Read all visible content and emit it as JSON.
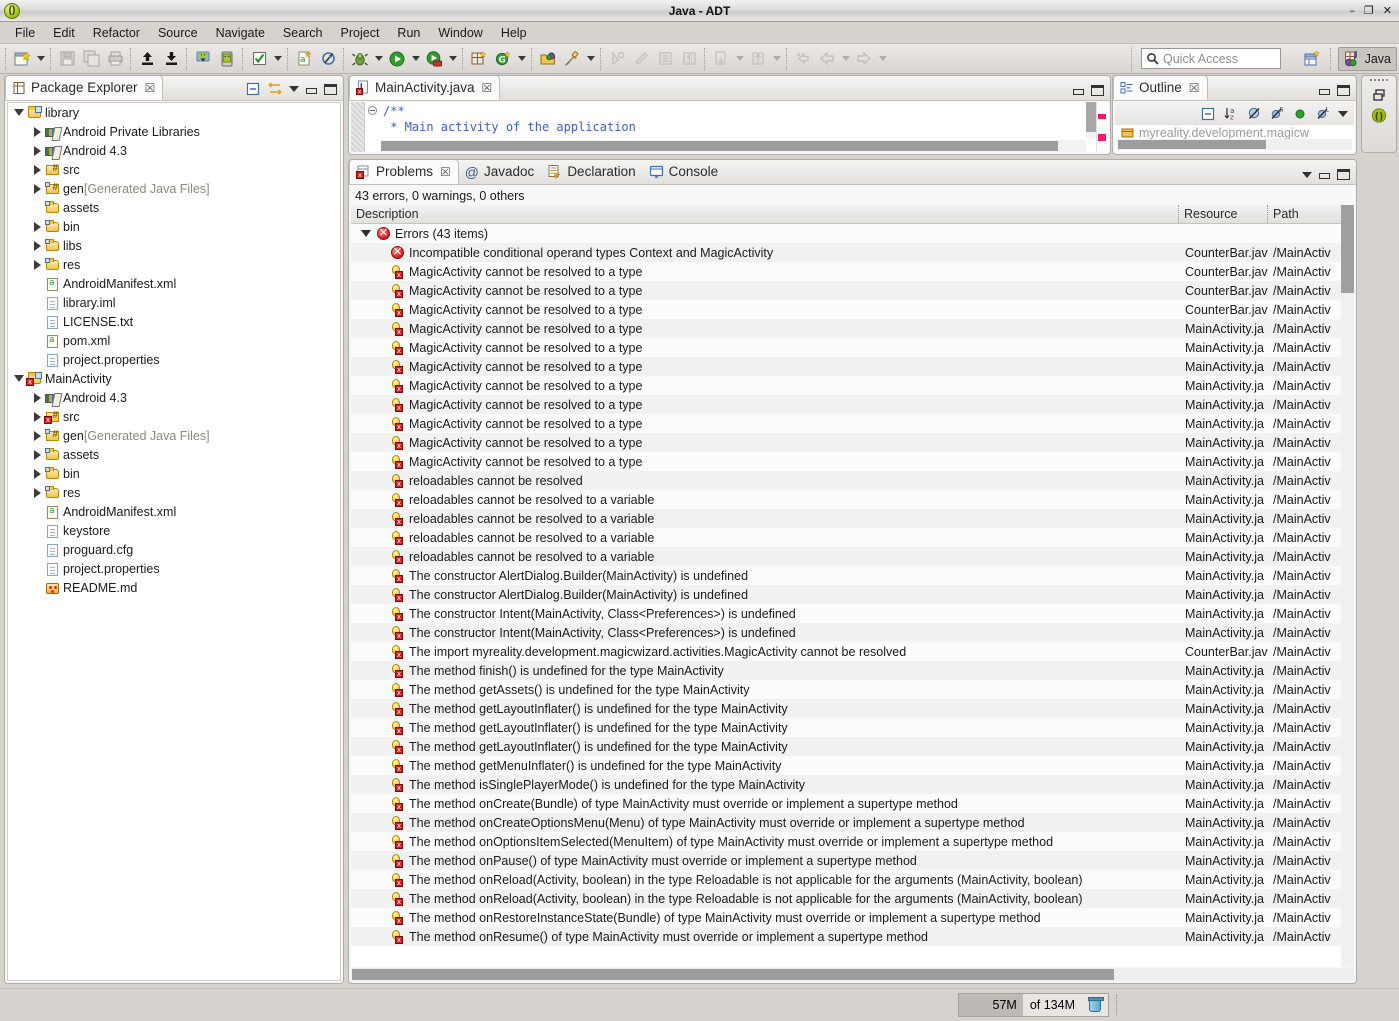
{
  "window": {
    "title": "Java - ADT",
    "app_icon": "eclipse-icon",
    "minimize": "–",
    "restore": "❐",
    "close": "✕"
  },
  "menubar": {
    "items": [
      "File",
      "Edit",
      "Refactor",
      "Source",
      "Navigate",
      "Search",
      "Project",
      "Run",
      "Window",
      "Help"
    ]
  },
  "toolbar": {
    "groups": [
      {
        "items": [
          {
            "name": "new-wizard-icon",
            "arrow": true
          },
          {
            "name": "save-icon",
            "arrow": false
          },
          {
            "name": "save-all-icon",
            "arrow": false
          },
          {
            "name": "print-icon",
            "arrow": false
          }
        ]
      },
      {
        "items": [
          {
            "name": "export-icon",
            "arrow": false
          },
          {
            "name": "import-icon",
            "arrow": false
          }
        ]
      },
      {
        "items": [
          {
            "name": "android-sdk-manager-icon",
            "arrow": false
          },
          {
            "name": "android-avd-manager-icon",
            "arrow": false
          }
        ]
      },
      {
        "items": [
          {
            "name": "build-check-icon",
            "arrow": true
          }
        ]
      },
      {
        "items": [
          {
            "name": "new-android-xml-icon",
            "arrow": false
          },
          {
            "name": "lint-warnings-icon",
            "arrow": false
          }
        ]
      },
      {
        "items": [
          {
            "name": "debug-icon",
            "arrow": true
          },
          {
            "name": "run-icon",
            "arrow": true
          },
          {
            "name": "run-history-icon",
            "arrow": true
          }
        ]
      },
      {
        "items": [
          {
            "name": "new-java-class-icon",
            "arrow": false
          },
          {
            "name": "new-java-project-icon",
            "arrow": true
          }
        ]
      },
      {
        "items": [
          {
            "name": "open-type-icon",
            "arrow": false
          },
          {
            "name": "search-icon",
            "arrow": true
          }
        ]
      },
      {
        "items": [
          {
            "name": "next-annotation-icon",
            "arrow": false
          },
          {
            "name": "previous-annotation-icon",
            "arrow": false
          },
          {
            "name": "toggle-block-selection-icon",
            "arrow": false
          },
          {
            "name": "show-whitespace-icon",
            "arrow": false
          }
        ]
      },
      {
        "items": [
          {
            "name": "last-edit-location-icon",
            "arrow": true
          },
          {
            "name": "go-to-line-icon",
            "arrow": true
          }
        ]
      },
      {
        "items": [
          {
            "name": "back-history-icon",
            "arrow": false
          },
          {
            "name": "back-icon",
            "arrow": true
          },
          {
            "name": "forward-icon",
            "arrow": true
          }
        ]
      }
    ],
    "quick_access": {
      "placeholder": "Quick Access",
      "value": "",
      "icon": "search-icon"
    },
    "open_perspective_icon": "open-perspective-icon",
    "perspective": {
      "label": "Java",
      "icon": "java-perspective-icon",
      "active": true
    }
  },
  "package_explorer": {
    "title": "Package Explorer",
    "close_glyph": "☒",
    "actions": [
      {
        "name": "collapse-all-icon"
      },
      {
        "name": "link-with-editor-icon"
      },
      {
        "name": "view-menu-icon"
      },
      {
        "name": "minimize-icon"
      },
      {
        "name": "maximize-icon"
      }
    ],
    "tree": [
      {
        "indent": 0,
        "twist": "open",
        "icon": "java-project-icon",
        "label": "library",
        "dim": ""
      },
      {
        "indent": 1,
        "twist": "closed",
        "icon": "library-icon",
        "label": "Android Private Libraries",
        "dim": ""
      },
      {
        "indent": 1,
        "twist": "closed",
        "icon": "library-icon",
        "label": "Android 4.3",
        "dim": ""
      },
      {
        "indent": 1,
        "twist": "closed",
        "icon": "source-folder-icon",
        "label": "src",
        "dim": ""
      },
      {
        "indent": 1,
        "twist": "closed",
        "icon": "gen-folder-icon",
        "label": "gen",
        "dim": "[Generated Java Files]"
      },
      {
        "indent": 1,
        "twist": "none",
        "icon": "folder-icon",
        "label": "assets",
        "dim": ""
      },
      {
        "indent": 1,
        "twist": "closed",
        "icon": "folder-icon",
        "label": "bin",
        "dim": ""
      },
      {
        "indent": 1,
        "twist": "closed",
        "icon": "folder-icon",
        "label": "libs",
        "dim": ""
      },
      {
        "indent": 1,
        "twist": "closed",
        "icon": "folder-icon",
        "label": "res",
        "dim": ""
      },
      {
        "indent": 1,
        "twist": "none",
        "icon": "xml-file-icon",
        "label": "AndroidManifest.xml",
        "dim": ""
      },
      {
        "indent": 1,
        "twist": "none",
        "icon": "file-icon",
        "label": "library.iml",
        "dim": ""
      },
      {
        "indent": 1,
        "twist": "none",
        "icon": "file-icon",
        "label": "LICENSE.txt",
        "dim": ""
      },
      {
        "indent": 1,
        "twist": "none",
        "icon": "xml-file-icon",
        "label": "pom.xml",
        "dim": ""
      },
      {
        "indent": 1,
        "twist": "none",
        "icon": "file-icon",
        "label": "project.properties",
        "dim": ""
      },
      {
        "indent": 0,
        "twist": "open",
        "icon": "java-project-error-icon",
        "label": "MainActivity",
        "dim": ""
      },
      {
        "indent": 1,
        "twist": "closed",
        "icon": "library-icon",
        "label": "Android 4.3",
        "dim": ""
      },
      {
        "indent": 1,
        "twist": "closed",
        "icon": "source-folder-error-icon",
        "label": "src",
        "dim": ""
      },
      {
        "indent": 1,
        "twist": "closed",
        "icon": "gen-folder-icon",
        "label": "gen",
        "dim": "[Generated Java Files]"
      },
      {
        "indent": 1,
        "twist": "closed",
        "icon": "folder-icon",
        "label": "assets",
        "dim": ""
      },
      {
        "indent": 1,
        "twist": "closed",
        "icon": "folder-icon",
        "label": "bin",
        "dim": ""
      },
      {
        "indent": 1,
        "twist": "closed",
        "icon": "folder-icon",
        "label": "res",
        "dim": ""
      },
      {
        "indent": 1,
        "twist": "none",
        "icon": "xml-file-icon",
        "label": "AndroidManifest.xml",
        "dim": ""
      },
      {
        "indent": 1,
        "twist": "none",
        "icon": "file-icon",
        "label": "keystore",
        "dim": ""
      },
      {
        "indent": 1,
        "twist": "none",
        "icon": "file-icon",
        "label": "proguard.cfg",
        "dim": ""
      },
      {
        "indent": 1,
        "twist": "none",
        "icon": "file-icon",
        "label": "project.properties",
        "dim": ""
      },
      {
        "indent": 1,
        "twist": "none",
        "icon": "markdown-file-icon",
        "label": "README.md",
        "dim": ""
      }
    ]
  },
  "editor": {
    "tab": {
      "label": "MainActivity.java",
      "icon": "java-file-error-icon",
      "close_glyph": "☒"
    },
    "lines": [
      "/**",
      " * Main activity of the application"
    ],
    "fold_marker": "collapse-fold-icon"
  },
  "outline": {
    "title": "Outline",
    "close_glyph": "☒",
    "actions": [
      {
        "name": "minimize-icon"
      },
      {
        "name": "maximize-icon"
      }
    ],
    "toolbar": [
      {
        "name": "collapse-all-icon"
      },
      {
        "name": "sort-icon"
      },
      {
        "name": "hide-fields-icon"
      },
      {
        "name": "hide-static-icon"
      },
      {
        "name": "hide-nonpublic-icon"
      },
      {
        "name": "hide-local-types-icon"
      },
      {
        "name": "view-menu-icon"
      }
    ],
    "rows": [
      {
        "icon": "package-icon",
        "label": "myreality.development.magicw"
      }
    ]
  },
  "problems": {
    "tabs": [
      {
        "label": "Problems",
        "icon": "problems-icon",
        "active": true,
        "close_glyph": "☒"
      },
      {
        "label": "Javadoc",
        "icon": "javadoc-icon",
        "active": false
      },
      {
        "label": "Declaration",
        "icon": "declaration-icon",
        "active": false
      },
      {
        "label": "Console",
        "icon": "console-icon",
        "active": false
      }
    ],
    "actions": [
      {
        "name": "view-menu-icon"
      },
      {
        "name": "minimize-icon"
      },
      {
        "name": "maximize-icon"
      }
    ],
    "summary": "43 errors, 0 warnings, 0 others",
    "columns": [
      "Description",
      "Resource",
      "Path"
    ],
    "group": {
      "twist": "open",
      "icon": "error-icon",
      "label": "Errors (43 items)"
    },
    "rows": [
      {
        "icon": "error-icon",
        "description": "Incompatible conditional operand types Context and MagicActivity",
        "resource": "CounterBar.jav",
        "path": "/MainActiv"
      },
      {
        "icon": "quickfix-error-icon",
        "description": "MagicActivity cannot be resolved to a type",
        "resource": "CounterBar.jav",
        "path": "/MainActiv"
      },
      {
        "icon": "quickfix-error-icon",
        "description": "MagicActivity cannot be resolved to a type",
        "resource": "CounterBar.jav",
        "path": "/MainActiv"
      },
      {
        "icon": "quickfix-error-icon",
        "description": "MagicActivity cannot be resolved to a type",
        "resource": "CounterBar.jav",
        "path": "/MainActiv"
      },
      {
        "icon": "quickfix-error-icon",
        "description": "MagicActivity cannot be resolved to a type",
        "resource": "MainActivity.ja",
        "path": "/MainActiv"
      },
      {
        "icon": "quickfix-error-icon",
        "description": "MagicActivity cannot be resolved to a type",
        "resource": "MainActivity.ja",
        "path": "/MainActiv"
      },
      {
        "icon": "quickfix-error-icon",
        "description": "MagicActivity cannot be resolved to a type",
        "resource": "MainActivity.ja",
        "path": "/MainActiv"
      },
      {
        "icon": "quickfix-error-icon",
        "description": "MagicActivity cannot be resolved to a type",
        "resource": "MainActivity.ja",
        "path": "/MainActiv"
      },
      {
        "icon": "quickfix-error-icon",
        "description": "MagicActivity cannot be resolved to a type",
        "resource": "MainActivity.ja",
        "path": "/MainActiv"
      },
      {
        "icon": "quickfix-error-icon",
        "description": "MagicActivity cannot be resolved to a type",
        "resource": "MainActivity.ja",
        "path": "/MainActiv"
      },
      {
        "icon": "quickfix-error-icon",
        "description": "MagicActivity cannot be resolved to a type",
        "resource": "MainActivity.ja",
        "path": "/MainActiv"
      },
      {
        "icon": "quickfix-error-icon",
        "description": "MagicActivity cannot be resolved to a type",
        "resource": "MainActivity.ja",
        "path": "/MainActiv"
      },
      {
        "icon": "quickfix-error-icon",
        "description": "reloadables cannot be resolved",
        "resource": "MainActivity.ja",
        "path": "/MainActiv"
      },
      {
        "icon": "quickfix-error-icon",
        "description": "reloadables cannot be resolved to a variable",
        "resource": "MainActivity.ja",
        "path": "/MainActiv"
      },
      {
        "icon": "quickfix-error-icon",
        "description": "reloadables cannot be resolved to a variable",
        "resource": "MainActivity.ja",
        "path": "/MainActiv"
      },
      {
        "icon": "quickfix-error-icon",
        "description": "reloadables cannot be resolved to a variable",
        "resource": "MainActivity.ja",
        "path": "/MainActiv"
      },
      {
        "icon": "quickfix-error-icon",
        "description": "reloadables cannot be resolved to a variable",
        "resource": "MainActivity.ja",
        "path": "/MainActiv"
      },
      {
        "icon": "quickfix-error-icon",
        "description": "The constructor AlertDialog.Builder(MainActivity) is undefined",
        "resource": "MainActivity.ja",
        "path": "/MainActiv"
      },
      {
        "icon": "quickfix-error-icon",
        "description": "The constructor AlertDialog.Builder(MainActivity) is undefined",
        "resource": "MainActivity.ja",
        "path": "/MainActiv"
      },
      {
        "icon": "quickfix-error-icon",
        "description": "The constructor Intent(MainActivity, Class<Preferences>) is undefined",
        "resource": "MainActivity.ja",
        "path": "/MainActiv"
      },
      {
        "icon": "quickfix-error-icon",
        "description": "The constructor Intent(MainActivity, Class<Preferences>) is undefined",
        "resource": "MainActivity.ja",
        "path": "/MainActiv"
      },
      {
        "icon": "quickfix-error-icon",
        "description": "The import myreality.development.magicwizard.activities.MagicActivity cannot be resolved",
        "resource": "CounterBar.jav",
        "path": "/MainActiv"
      },
      {
        "icon": "quickfix-error-icon",
        "description": "The method finish() is undefined for the type MainActivity",
        "resource": "MainActivity.ja",
        "path": "/MainActiv"
      },
      {
        "icon": "quickfix-error-icon",
        "description": "The method getAssets() is undefined for the type MainActivity",
        "resource": "MainActivity.ja",
        "path": "/MainActiv"
      },
      {
        "icon": "quickfix-error-icon",
        "description": "The method getLayoutInflater() is undefined for the type MainActivity",
        "resource": "MainActivity.ja",
        "path": "/MainActiv"
      },
      {
        "icon": "quickfix-error-icon",
        "description": "The method getLayoutInflater() is undefined for the type MainActivity",
        "resource": "MainActivity.ja",
        "path": "/MainActiv"
      },
      {
        "icon": "quickfix-error-icon",
        "description": "The method getLayoutInflater() is undefined for the type MainActivity",
        "resource": "MainActivity.ja",
        "path": "/MainActiv"
      },
      {
        "icon": "quickfix-error-icon",
        "description": "The method getMenuInflater() is undefined for the type MainActivity",
        "resource": "MainActivity.ja",
        "path": "/MainActiv"
      },
      {
        "icon": "quickfix-error-icon",
        "description": "The method isSinglePlayerMode() is undefined for the type MainActivity",
        "resource": "MainActivity.ja",
        "path": "/MainActiv"
      },
      {
        "icon": "quickfix-error-icon",
        "description": "The method onCreate(Bundle) of type MainActivity must override or implement a supertype method",
        "resource": "MainActivity.ja",
        "path": "/MainActiv"
      },
      {
        "icon": "quickfix-error-icon",
        "description": "The method onCreateOptionsMenu(Menu) of type MainActivity must override or implement a supertype method",
        "resource": "MainActivity.ja",
        "path": "/MainActiv"
      },
      {
        "icon": "quickfix-error-icon",
        "description": "The method onOptionsItemSelected(MenuItem) of type MainActivity must override or implement a supertype method",
        "resource": "MainActivity.ja",
        "path": "/MainActiv"
      },
      {
        "icon": "quickfix-error-icon",
        "description": "The method onPause() of type MainActivity must override or implement a supertype method",
        "resource": "MainActivity.ja",
        "path": "/MainActiv"
      },
      {
        "icon": "quickfix-error-icon",
        "description": "The method onReload(Activity, boolean) in the type Reloadable is not applicable for the arguments (MainActivity, boolean)",
        "resource": "MainActivity.ja",
        "path": "/MainActiv"
      },
      {
        "icon": "quickfix-error-icon",
        "description": "The method onReload(Activity, boolean) in the type Reloadable is not applicable for the arguments (MainActivity, boolean)",
        "resource": "MainActivity.ja",
        "path": "/MainActiv"
      },
      {
        "icon": "quickfix-error-icon",
        "description": "The method onRestoreInstanceState(Bundle) of type MainActivity must override or implement a supertype method",
        "resource": "MainActivity.ja",
        "path": "/MainActiv"
      },
      {
        "icon": "quickfix-error-icon",
        "description": "The method onResume() of type MainActivity must override or implement a supertype method",
        "resource": "MainActivity.ja",
        "path": "/MainActiv"
      }
    ]
  },
  "fastview": {
    "items": [
      {
        "name": "restore-icon"
      },
      {
        "name": "eclipse-icon"
      }
    ]
  },
  "statusbar": {
    "heap_used": "57M",
    "heap_total": "of 134M",
    "gc_icon": "trash-icon"
  },
  "colors": {
    "chrome": "#d6d2ce",
    "view_bg": "#f7f7f7",
    "error_red": "#d01616",
    "comment_blue": "#3f5fbf",
    "accent_green": "#9cbc1c"
  }
}
